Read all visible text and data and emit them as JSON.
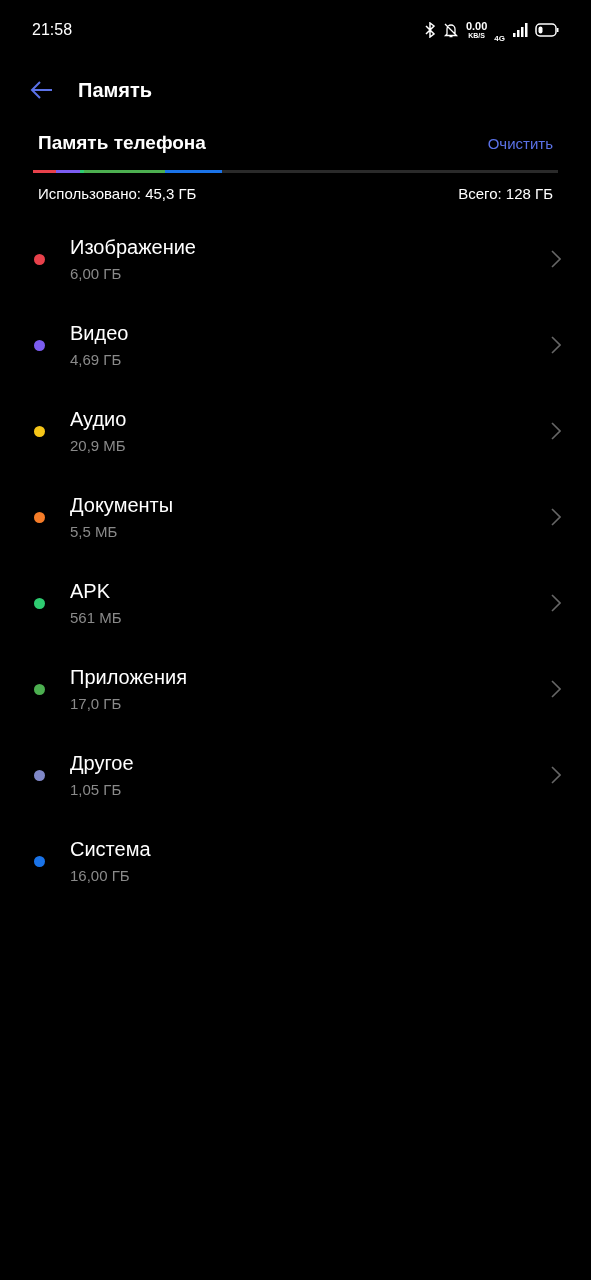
{
  "status_bar": {
    "time": "21:58",
    "speed": "0.00",
    "speed_unit": "KB/S",
    "network": "4G"
  },
  "header": {
    "title": "Память"
  },
  "storage": {
    "title": "Память телефона",
    "action": "Очистить",
    "used": "Использовано: 45,3  ГБ",
    "level": 0.36,
    "total": "Всего: 128 ГБ"
  },
  "categories": [
    {
      "name": "Изображение",
      "size": "6,00 ГБ",
      "color": "#e8414b",
      "chevron": true
    },
    {
      "name": "Видео",
      "size": "4,69 ГБ",
      "color": "#7b5cf0",
      "chevron": true
    },
    {
      "name": "Аудио",
      "size": "20,9 МБ",
      "color": "#f5c518",
      "chevron": true
    },
    {
      "name": "Документы",
      "size": "5,5 МБ",
      "color": "#f57c28",
      "chevron": true
    },
    {
      "name": "APK",
      "size": "561 МБ",
      "color": "#2ecc71",
      "chevron": true
    },
    {
      "name": "Приложения",
      "size": "17,0 ГБ",
      "color": "#4caf50",
      "chevron": true
    },
    {
      "name": "Другое",
      "size": "1,05 ГБ",
      "color": "#8088c8",
      "chevron": true
    },
    {
      "name": "Система",
      "size": "16,00 ГБ",
      "color": "#1a73e8",
      "chevron": false
    }
  ]
}
